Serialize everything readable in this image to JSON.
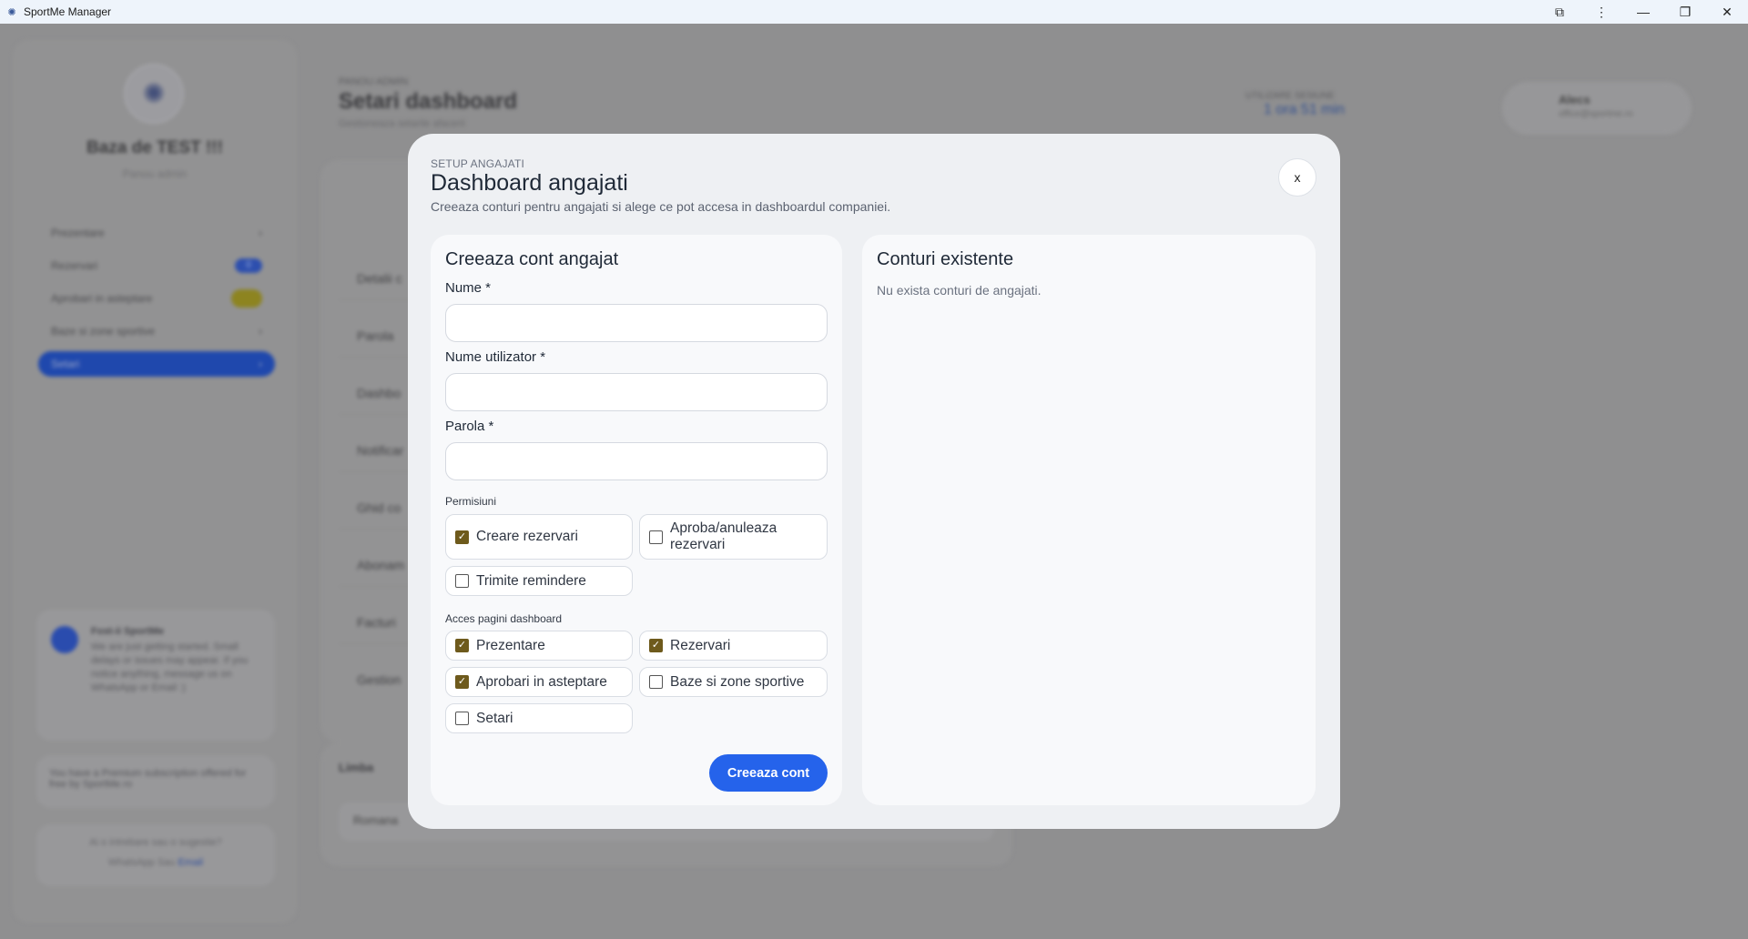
{
  "window": {
    "title": "SportMe Manager",
    "controls": [
      "⧉",
      "⋮",
      "—",
      "❐",
      "✕"
    ]
  },
  "background": {
    "brand": "Baza de TEST !!!",
    "brand_sub": "Panou admin",
    "nav": [
      {
        "label": "Prezentare",
        "trail": "›"
      },
      {
        "label": "Rezervari",
        "trail": "0"
      },
      {
        "label": "Aprobari in asteptare",
        "trail": ""
      },
      {
        "label": "Baze si zone sportive",
        "trail": "›"
      },
      {
        "label": "Setari",
        "trail": "›"
      }
    ],
    "eyebrow": "PANOU ADMIN",
    "page_title": "Setari dashboard",
    "page_sub": "Gestioneaza setarile afacerii",
    "stat_label": "UTILIZARE SESIUNE",
    "stat_value": "1 ora 51 min",
    "user_name": "Alecs",
    "user_email": "office@sportme.ro",
    "rows": [
      "Detalii c",
      "Parola",
      "Dashbo",
      "Notificar",
      "Ghid co",
      "Abonam",
      "Facturi",
      "Gestion"
    ],
    "lang_title": "Limba",
    "lang_value": "Romana",
    "promo_title": "Fost-ii SportMe",
    "promo_text": "We are just getting started. Small delays or issues may appear. If you notice anything, message us on WhatsApp or Email :)",
    "premium_text": "You have a Premium subscription offered for free by SportMe.ro",
    "contact_question": "Ai o intrebare sau o sugestie?",
    "contact_whatsapp": "WhatsApp",
    "contact_sep": "Sau",
    "contact_email": "Email"
  },
  "modal": {
    "eyebrow": "SETUP ANGAJATI",
    "title": "Dashboard angajati",
    "subtitle": "Creeaza conturi pentru angajati si alege ce pot accesa in dashboardul companiei.",
    "close_label": "x",
    "create": {
      "title": "Creeaza cont angajat",
      "name_label": "Nume *",
      "username_label": "Nume utilizator *",
      "password_label": "Parola *",
      "name_value": "",
      "username_value": "",
      "password_value": "",
      "permissions_label": "Permisiuni",
      "permissions": [
        {
          "label": "Creare rezervari",
          "checked": true
        },
        {
          "label": "Aproba/anuleaza rezervari",
          "checked": false
        },
        {
          "label": "Trimite remindere",
          "checked": false
        }
      ],
      "pages_label": "Acces pagini dashboard",
      "pages": [
        {
          "label": "Prezentare",
          "checked": true
        },
        {
          "label": "Rezervari",
          "checked": true
        },
        {
          "label": "Aprobari in asteptare",
          "checked": true
        },
        {
          "label": "Baze si zone sportive",
          "checked": false
        },
        {
          "label": "Setari",
          "checked": false
        }
      ],
      "submit_label": "Creeaza cont"
    },
    "existing": {
      "title": "Conturi existente",
      "empty_text": "Nu exista conturi de angajati."
    }
  }
}
